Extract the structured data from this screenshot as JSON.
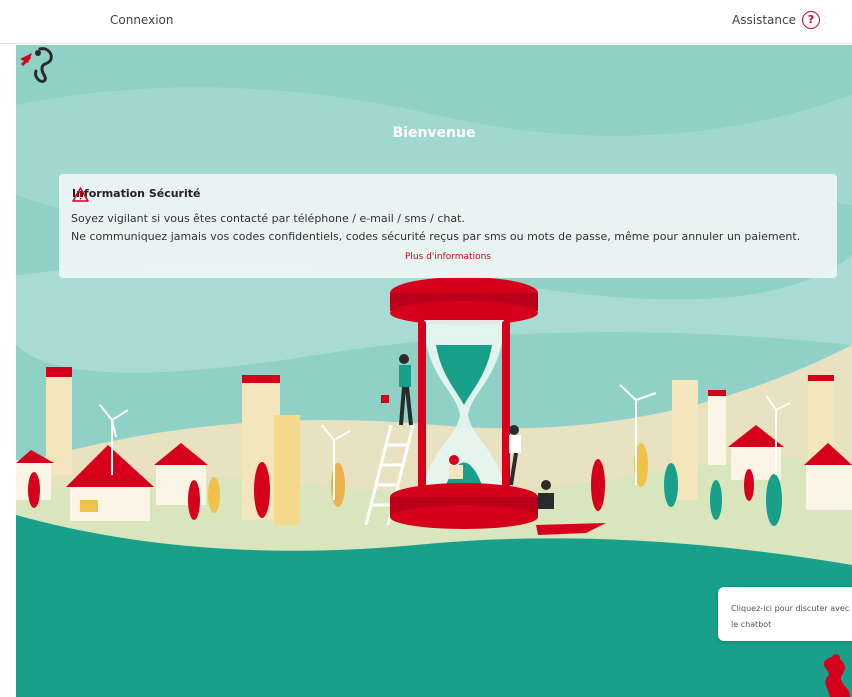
{
  "header": {
    "login_label": "Connexion",
    "help_label": "Assistance",
    "help_icon": "question-circle-icon",
    "accent_color": "#d6001c"
  },
  "hero": {
    "welcome_title": "Bienvenue",
    "logo_icon": "bank-logo-icon",
    "illustration": "hourglass-city-illustration"
  },
  "security_notice": {
    "icon": "warning-triangle-icon",
    "title": "Information Sécurité",
    "line1": "Soyez vigilant si vous êtes contacté par téléphone / e-mail / sms / chat.",
    "line2": "Ne communiquez jamais vos codes confidentiels, codes sécurité reçus par sms ou mots de passe, même pour annuler un paiement.",
    "more_link": "Plus d'informations"
  },
  "chatbot": {
    "text": "Cliquez-ici pour discuter avec le chatbot",
    "avatar_icon": "chatbot-avatar-icon"
  }
}
